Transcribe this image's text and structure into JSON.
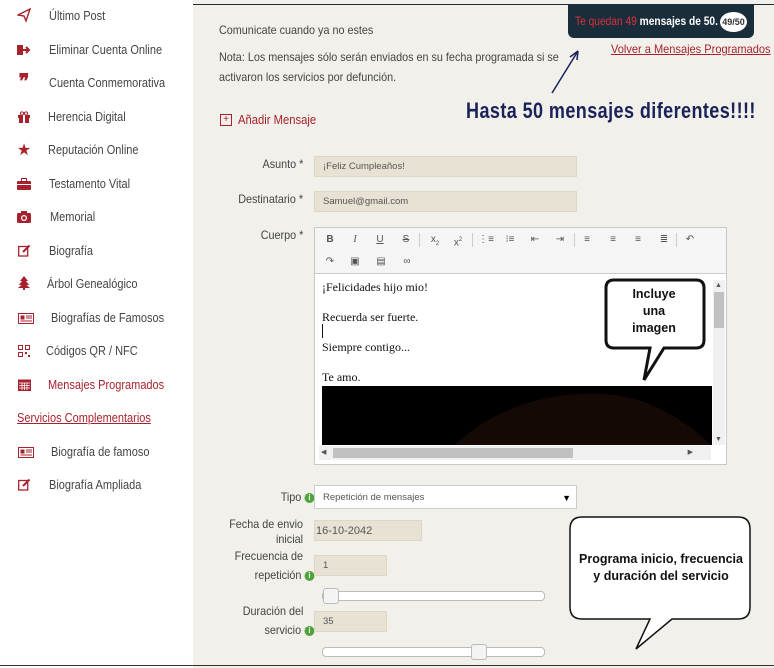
{
  "sidebar": {
    "items": [
      {
        "label": "Último Post",
        "icon": "paper-plane-icon"
      },
      {
        "label": "Eliminar Cuenta Online",
        "icon": "sign-out-icon"
      },
      {
        "label": "Cuenta Conmemorativa",
        "icon": "quote-icon"
      },
      {
        "label": "Herencia Digital",
        "icon": "gift-icon"
      },
      {
        "label": "Reputación Online",
        "icon": "star-icon"
      },
      {
        "label": "Testamento Vital",
        "icon": "briefcase-icon"
      },
      {
        "label": "Memorial",
        "icon": "camera-icon"
      },
      {
        "label": "Biografía",
        "icon": "edit-icon"
      },
      {
        "label": "Árbol Genealógico",
        "icon": "tree-icon"
      },
      {
        "label": "Biografías de Famosos",
        "icon": "newspaper-icon"
      },
      {
        "label": "Códigos QR / NFC",
        "icon": "qr-code-icon"
      },
      {
        "label": "Mensajes Programados",
        "icon": "calendar-icon",
        "active": true
      }
    ],
    "services_title": "Servicios Complementarios",
    "services": [
      {
        "label": "Biografía de famoso",
        "icon": "newspaper-icon"
      },
      {
        "label": "Biografía Ampliada",
        "icon": "edit-icon"
      }
    ]
  },
  "header": {
    "intro": "Comunicate cuando ya no estes",
    "note_line1": "Nota: Los mensajes sólo serán enviados en su fecha programada si se",
    "note_line2": "activaron los servicios por defunción.",
    "counter_prefix": "Te quedan 49",
    "counter_suffix": " mensajes de 50.",
    "counter_badge": "49/50",
    "back_link": "Volver a Mensajes Programados"
  },
  "add_message": "Añadir Mensaje",
  "annotation_main": "Hasta 50 mensajes diferentes!!!!",
  "callout_image": [
    "Incluye",
    "una",
    "imagen"
  ],
  "callout_program": [
    "Programa inicio, frecuencia",
    "y duración del servicio"
  ],
  "form": {
    "asunto_label": "Asunto *",
    "asunto_value": "¡Feliz Cumpleaños!",
    "dest_label": "Destinatario *",
    "dest_value": "Samuel@gmail.com",
    "cuerpo_label": "Cuerpo *",
    "body_lines": [
      "¡Felicidades hijo mio!",
      "Recuerda ser fuerte.",
      "Siempre contigo...",
      "Te amo."
    ],
    "tipo_label": "Tipo",
    "tipo_value": "Repetición de mensajes",
    "fecha_label_1": "Fecha de envio",
    "fecha_label_2": "inicial",
    "fecha_value": "16-10-2042",
    "frec_label_1": "Frecuencia de",
    "frec_label_2": "repetición",
    "frec_value": "1",
    "frec_slider_fraction": 0.0,
    "dur_label_1": "Duración del",
    "dur_label_2": "servicio",
    "dur_value": "35",
    "dur_slider_fraction": 0.72
  },
  "toolbar_icons": [
    "bold-icon",
    "italic-icon",
    "underline-icon",
    "strikethrough-icon",
    "subscript-icon",
    "superscript-icon",
    "numbered-list-icon",
    "bullet-list-icon",
    "outdent-icon",
    "indent-icon",
    "align-left-icon",
    "align-center-icon",
    "align-right-icon",
    "justify-icon",
    "undo-icon",
    "redo-icon",
    "image-icon",
    "table-icon",
    "link-icon"
  ],
  "colors": {
    "accent": "#a8222d",
    "navy": "#1a2d3b",
    "annotation": "#1a2258",
    "field": "#e7e2d3",
    "info": "#4ea43c"
  }
}
